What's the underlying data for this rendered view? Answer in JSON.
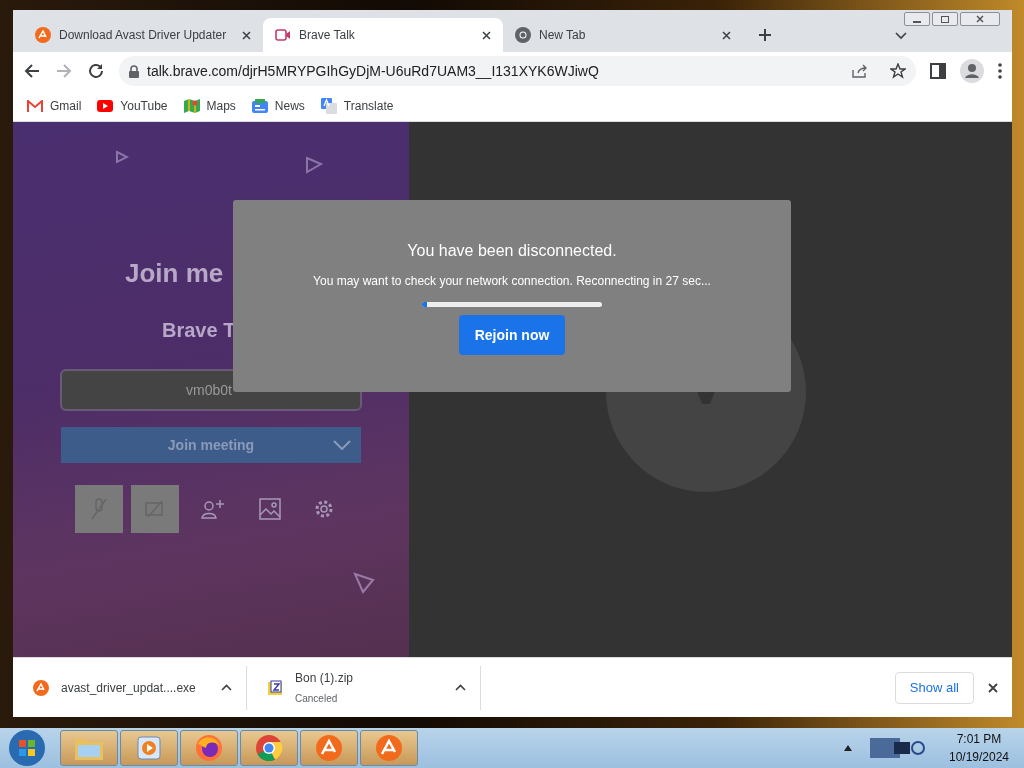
{
  "tabs": [
    {
      "title": "Download Avast Driver Updater",
      "kind": "avast",
      "selected": false
    },
    {
      "title": "Brave Talk",
      "kind": "camera",
      "selected": true
    },
    {
      "title": "New Tab",
      "kind": "chrome",
      "selected": false
    }
  ],
  "address_bar": {
    "url": "talk.brave.com/djrH5MRYPGIhGyDjM-U6uRd7UAM3__I131XYK6WJiwQ"
  },
  "bookmarks": [
    {
      "label": "Gmail",
      "kind": "gmail"
    },
    {
      "label": "YouTube",
      "kind": "youtube"
    },
    {
      "label": "Maps",
      "kind": "maps"
    },
    {
      "label": "News",
      "kind": "news"
    },
    {
      "label": "Translate",
      "kind": "translate"
    }
  ],
  "join_panel": {
    "heading": "Join me",
    "subheading": "Brave T",
    "name_field": "vm0b0t",
    "join_button": "Join meeting"
  },
  "dialog": {
    "title": "You have been disconnected.",
    "message": "You may want to check your network connection. Reconnecting in 27 sec...",
    "progress": {
      "level": 0.03
    },
    "button": "Rejoin now"
  },
  "downloads": [
    {
      "file": "avast_driver_updat....exe",
      "kind": "avast"
    },
    {
      "file": "Bon (1).zip",
      "status": "Canceled",
      "kind": "zip"
    }
  ],
  "downloads_bar": {
    "show_all": "Show all"
  },
  "taskbar": {
    "apps": [
      {
        "kind": "folder"
      },
      {
        "kind": "media"
      },
      {
        "kind": "firefox"
      },
      {
        "kind": "chrome"
      },
      {
        "kind": "avast"
      },
      {
        "kind": "avast"
      }
    ],
    "time": "7:01 PM",
    "date": "10/19/2024"
  }
}
